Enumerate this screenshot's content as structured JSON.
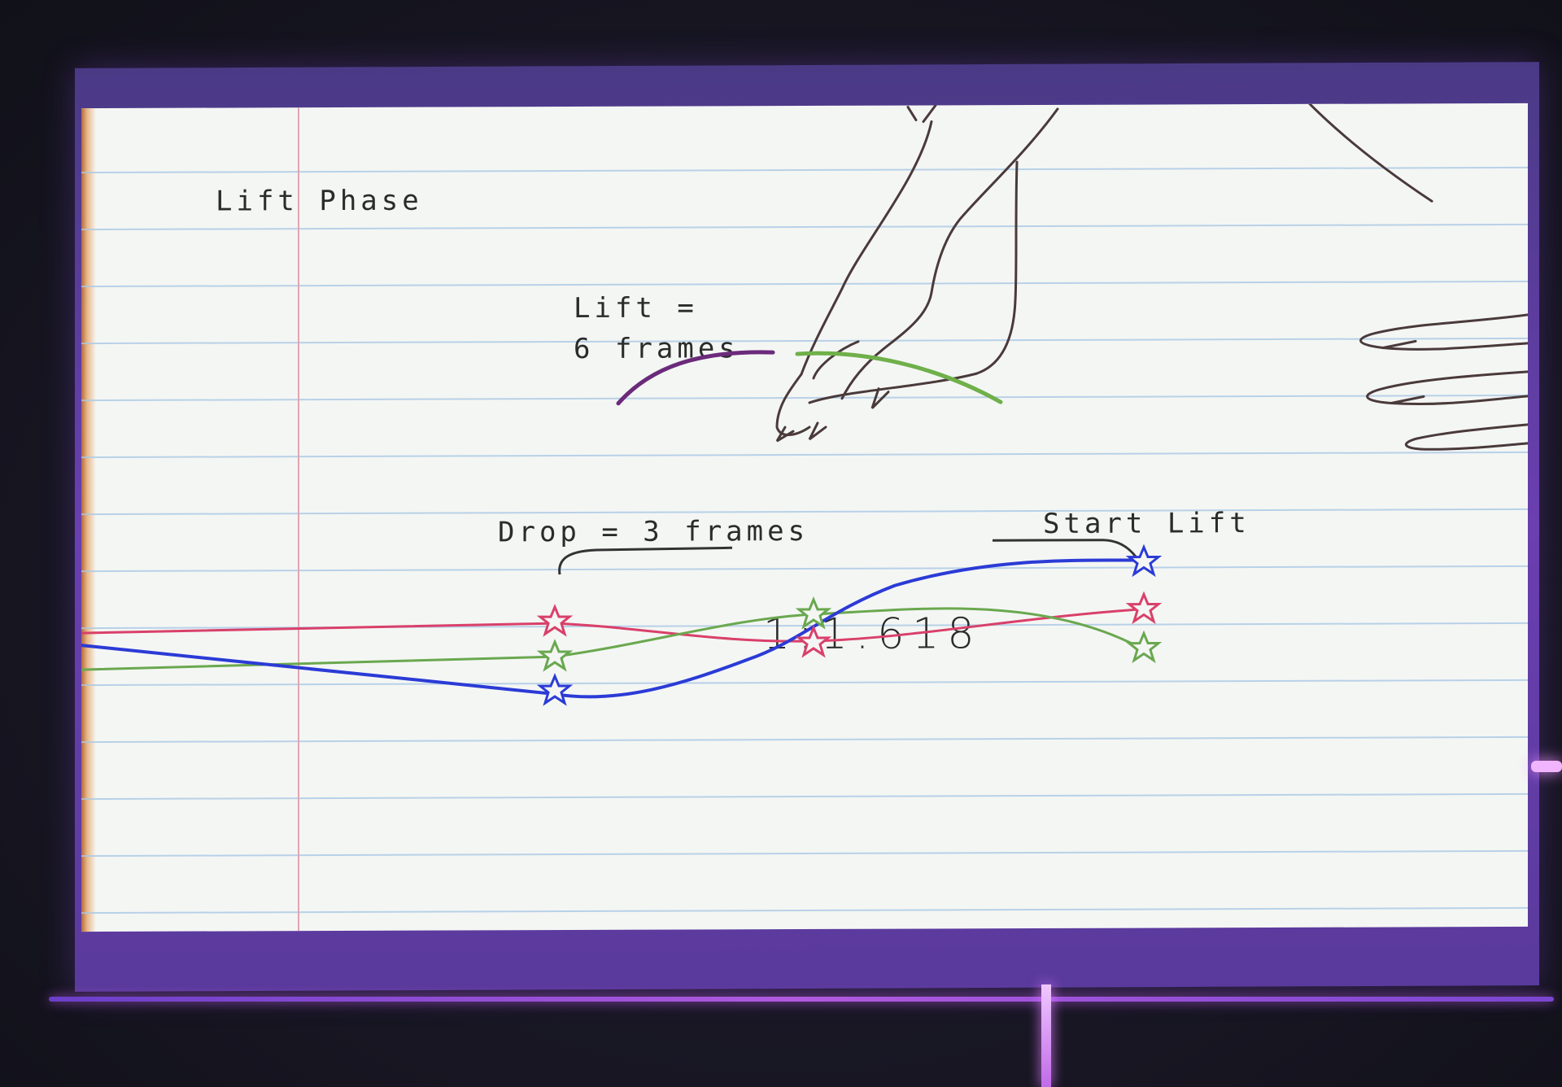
{
  "slide": {
    "title": "Lift Phase",
    "lift_label_line1": "Lift =",
    "lift_label_line2": "6 frames",
    "drop_label": "Drop = 3 frames",
    "start_lift_label": "Start Lift",
    "ratio_label": "1:1.618"
  },
  "curve_colors": {
    "red": "#d9406a",
    "green": "#6aa84f",
    "blue": "#2b3bd6",
    "arc_purple": "#6b2a7a",
    "arc_green": "#6fb04a"
  },
  "icons": [
    "star-keyframe-icon",
    "cat-paw-sketch",
    "cat-claws-sketch"
  ]
}
